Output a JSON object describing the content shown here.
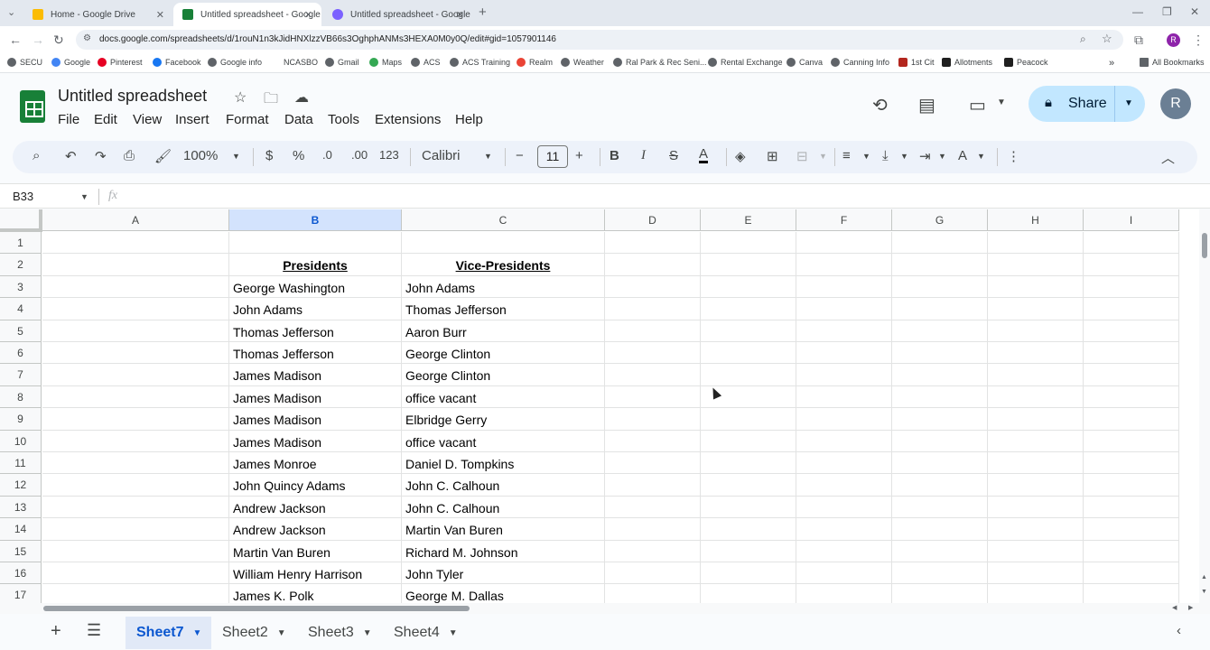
{
  "browser": {
    "tabs": [
      {
        "title": "Home - Google Drive",
        "active": false,
        "color": "#fbbc04"
      },
      {
        "title": "Untitled spreadsheet - Google",
        "active": true,
        "color": "#188038"
      },
      {
        "title": "Untitled spreadsheet - Google",
        "active": false,
        "color": "#7b61ff"
      }
    ],
    "url": "docs.google.com/spreadsheets/d/1rouN1n3kJidHNXlzzVB66s3OghphANMs3HEXA0M0y0Q/edit#gid=1057901146",
    "avatar": "R",
    "bookmarks": [
      "SECU",
      "Google",
      "Pinterest",
      "Facebook",
      "Google info",
      "NCASBO",
      "Gmail",
      "Maps",
      "ACS",
      "ACS Training",
      "Realm",
      "Weather",
      "Ral Park & Rec Seni...",
      "Rental Exchange",
      "Canva",
      "Canning Info",
      "1st Cit",
      "Allotments",
      "Peacock"
    ],
    "all_bookmarks": "All Bookmarks"
  },
  "doc": {
    "title": "Untitled spreadsheet",
    "menus": [
      "File",
      "Edit",
      "View",
      "Insert",
      "Format",
      "Data",
      "Tools",
      "Extensions",
      "Help"
    ],
    "share_label": "Share",
    "user_initial": "R"
  },
  "toolbar": {
    "zoom": "100%",
    "currency": "$",
    "percent": "%",
    "dec_decrease": ".0",
    "dec_increase": ".00",
    "format_123": "123",
    "font": "Calibri",
    "font_size": "11"
  },
  "formula_bar": {
    "name_box": "B33",
    "fx": "fx",
    "value": ""
  },
  "grid": {
    "selected_column": "B",
    "columns": [
      "A",
      "B",
      "C",
      "D",
      "E",
      "F",
      "G",
      "H",
      "I"
    ],
    "rows": [
      "1",
      "2",
      "3",
      "4",
      "5",
      "6",
      "7",
      "8",
      "9",
      "10",
      "11",
      "12",
      "13",
      "14",
      "15",
      "16",
      "17"
    ],
    "header_row": {
      "b": "Presidents",
      "c": "Vice-Presidents"
    },
    "data": [
      {
        "b": "George Washington",
        "c": "John Adams"
      },
      {
        "b": "John Adams",
        "c": "Thomas Jefferson"
      },
      {
        "b": "Thomas Jefferson",
        "c": "Aaron Burr"
      },
      {
        "b": "Thomas Jefferson",
        "c": "George Clinton"
      },
      {
        "b": "James Madison",
        "c": "George Clinton"
      },
      {
        "b": "James Madison",
        "c": "office vacant"
      },
      {
        "b": "James Madison",
        "c": "Elbridge Gerry"
      },
      {
        "b": "James Madison",
        "c": "office vacant"
      },
      {
        "b": "James Monroe",
        "c": "Daniel D. Tompkins"
      },
      {
        "b": "John Quincy Adams",
        "c": "John C. Calhoun"
      },
      {
        "b": "Andrew Jackson",
        "c": "John C. Calhoun"
      },
      {
        "b": "Andrew Jackson",
        "c": "Martin Van Buren"
      },
      {
        "b": "Martin Van Buren",
        "c": "Richard M. Johnson"
      },
      {
        "b": "William Henry Harrison",
        "c": "John Tyler"
      },
      {
        "b": "James K. Polk",
        "c": "George M. Dallas"
      }
    ]
  },
  "sheets": [
    {
      "name": "Sheet7",
      "active": true
    },
    {
      "name": "Sheet2",
      "active": false
    },
    {
      "name": "Sheet3",
      "active": false
    },
    {
      "name": "Sheet4",
      "active": false
    }
  ],
  "icons": {
    "back": "back-arrow-icon",
    "forward": "forward-arrow-icon",
    "reload": "reload-icon",
    "star": "star-icon",
    "lock": "lock-icon",
    "history": "history-icon",
    "comment": "comment-icon",
    "meet": "video-icon"
  }
}
